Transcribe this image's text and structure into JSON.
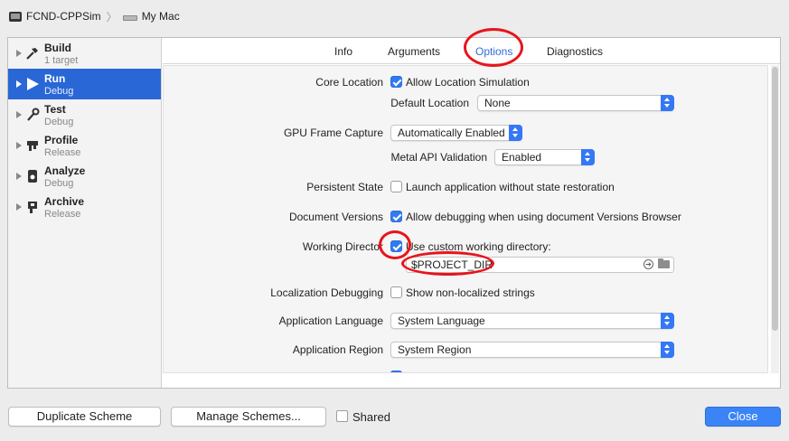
{
  "scheme": {
    "target": "FCND-CPPSim",
    "destination": "My Mac"
  },
  "sidebar": {
    "items": [
      {
        "title": "Build",
        "sub": "1 target",
        "icon": "hammer-icon"
      },
      {
        "title": "Run",
        "sub": "Debug",
        "icon": "play-icon"
      },
      {
        "title": "Test",
        "sub": "Debug",
        "icon": "wrench-icon"
      },
      {
        "title": "Profile",
        "sub": "Release",
        "icon": "gauge-icon"
      },
      {
        "title": "Analyze",
        "sub": "Debug",
        "icon": "analyze-icon"
      },
      {
        "title": "Archive",
        "sub": "Release",
        "icon": "archive-icon"
      }
    ]
  },
  "tabs": [
    "Info",
    "Arguments",
    "Options",
    "Diagnostics"
  ],
  "options": {
    "core_location_label": "Core Location",
    "allow_location_sim": "Allow Location Simulation",
    "default_location_label": "Default Location",
    "default_location_value": "None",
    "gpu_label": "GPU Frame Capture",
    "gpu_value": "Automatically Enabled",
    "metal_label": "Metal API Validation",
    "metal_value": "Enabled",
    "persistent_label": "Persistent State",
    "persistent_text": "Launch application without state restoration",
    "docversions_label": "Document Versions",
    "docversions_text": "Allow debugging when using document Versions Browser",
    "workdir_label": "Working Director",
    "workdir_text": "Use custom working directory:",
    "workdir_path": "$PROJECT_DIR",
    "localization_label": "Localization Debugging",
    "localization_text": "Show non-localized strings",
    "app_language_label": "Application Language",
    "app_language_value": "System Language",
    "app_region_label": "Application Region",
    "app_region_value": "System Region"
  },
  "footer": {
    "duplicate": "Duplicate Scheme",
    "manage": "Manage Schemes...",
    "shared": "Shared",
    "close": "Close"
  },
  "colors": {
    "selection": "#2a67d6",
    "accent": "#3478f6",
    "annotation": "#e8141c"
  }
}
